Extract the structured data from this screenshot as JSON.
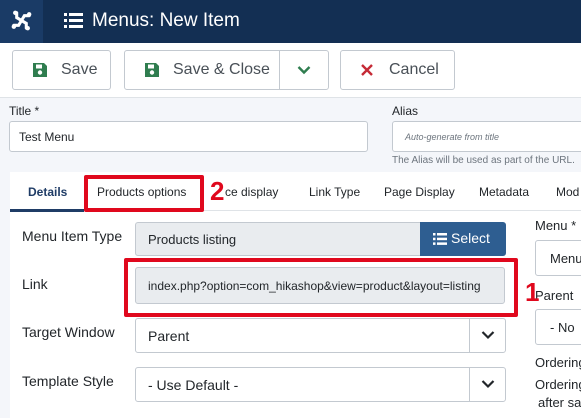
{
  "header": {
    "logo_icon": "joomla-logo-icon",
    "menu_icon": "list-icon",
    "title": "Menus: New Item"
  },
  "toolbar": {
    "save_label": "Save",
    "save_close_label": "Save & Close",
    "cancel_label": "Cancel",
    "save_icon": "floppy-disk-icon",
    "cancel_icon": "x-icon",
    "dropdown_icon": "chevron-down-icon",
    "colors": {
      "save_icon": "#2f7d4f",
      "cancel_icon": "#c52a36"
    }
  },
  "form": {
    "title_label": "Title *",
    "title_value": "Test Menu",
    "alias_label": "Alias",
    "alias_placeholder": "Auto-generate from title",
    "alias_help": "The Alias will be used as part of the URL."
  },
  "tabs": [
    {
      "label": "Details",
      "active": true
    },
    {
      "label": "Products options"
    },
    {
      "label": "ce display"
    },
    {
      "label": "Link Type"
    },
    {
      "label": "Page Display"
    },
    {
      "label": "Metadata"
    },
    {
      "label": "Mod"
    }
  ],
  "fields": {
    "menu_item_type_label": "Menu Item Type",
    "menu_item_type_value": "Products listing",
    "select_label": "Select",
    "link_label": "Link",
    "link_value": "index.php?option=com_hikashop&view=product&layout=listing",
    "target_window_label": "Target Window",
    "target_window_value": "Parent",
    "template_style_label": "Template Style",
    "template_style_value": "- Use Default -"
  },
  "right_column": {
    "menu_label": "Menu *",
    "menu_value": "Menu",
    "parent_label": "Parent",
    "parent_value": "- No",
    "ordering_label": "Ordering",
    "ordering_text": "Ordering",
    "after_save_text": "after sa"
  },
  "annotations": {
    "color": "#e0081d",
    "marker_1": "1",
    "marker_2": "2"
  }
}
